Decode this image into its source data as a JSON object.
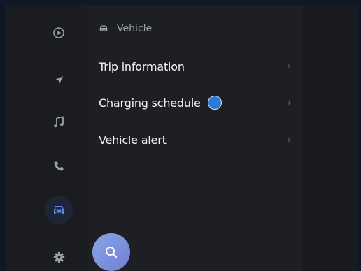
{
  "sidebar": {
    "items": [
      {
        "name": "media",
        "icon": "play-circle-icon"
      },
      {
        "name": "navigation",
        "icon": "navigation-arrow-icon"
      },
      {
        "name": "music",
        "icon": "music-note-icon"
      },
      {
        "name": "phone",
        "icon": "phone-icon"
      },
      {
        "name": "vehicle",
        "icon": "car-icon",
        "active": true
      },
      {
        "name": "settings",
        "icon": "gear-icon"
      }
    ]
  },
  "header": {
    "title": "Vehicle",
    "icon": "car-icon"
  },
  "menu": {
    "items": [
      {
        "label": "Trip information",
        "chevron": "›"
      },
      {
        "label": "Charging schedule",
        "chevron": "›",
        "indicator": true
      },
      {
        "label": "Vehicle alert",
        "chevron": "›"
      }
    ]
  },
  "search": {
    "icon": "search-icon"
  },
  "colors": {
    "accent": "#4f7fd8",
    "indicator": "#2a7bd1",
    "text_primary": "#f1f2f4",
    "text_secondary": "#9ea3aa"
  }
}
